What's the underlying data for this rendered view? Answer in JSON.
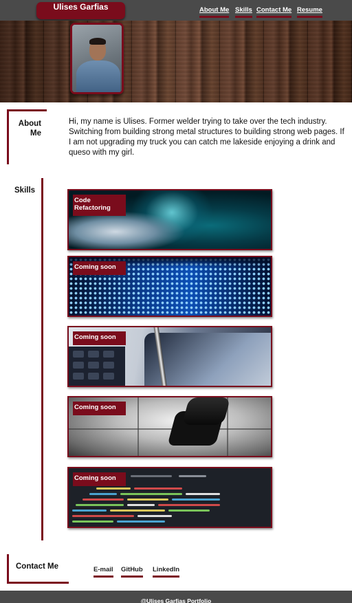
{
  "header": {
    "brand": "Ulises Garfias",
    "nav": [
      "About Me",
      "Skills",
      "Contact Me",
      "Resume"
    ]
  },
  "about": {
    "heading": "About Me",
    "text": "Hi, my name is Ulises. Former welder trying to take over the tech industry. Switching from building strong metal structures to building strong web pages. If I am not upgrading my truck you can catch me lakeside enjoying a drink and queso with my girl."
  },
  "skills": {
    "heading": "Skills",
    "cards": [
      {
        "label": "Code Refactoring",
        "image": "ocean-wave"
      },
      {
        "label": "Coming soon",
        "image": "blue-light-dots"
      },
      {
        "label": "Coming soon",
        "image": "calculator-pen"
      },
      {
        "label": "Coming soon",
        "image": "puzzle-pieces"
      },
      {
        "label": "Coming soon",
        "image": "code-screen"
      }
    ]
  },
  "contact": {
    "heading": "Contact Me",
    "links": [
      "E-mail",
      "GitHub",
      "LinkedIn"
    ]
  },
  "footer": {
    "text": "@Ulises Garfias Portfolio"
  },
  "colors": {
    "accent": "#7a0c1c",
    "bar": "#4a4a4a"
  }
}
